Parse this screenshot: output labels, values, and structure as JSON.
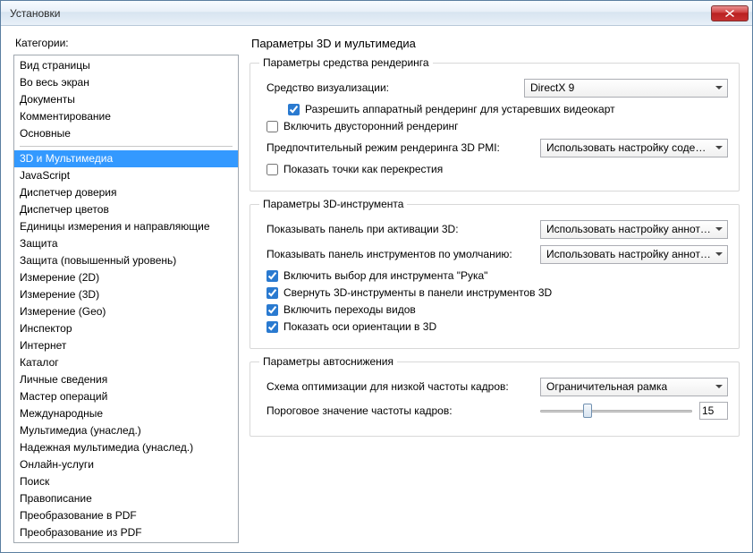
{
  "window": {
    "title": "Установки"
  },
  "sidebar": {
    "label": "Категории:",
    "group1": [
      "Вид страницы",
      "Во весь экран",
      "Документы",
      "Комментирование",
      "Основные"
    ],
    "group2": [
      "3D и Мультимедиа",
      "JavaScript",
      "Диспетчер доверия",
      "Диспетчер цветов",
      "Единицы измерения и направляющие",
      "Защита",
      "Защита (повышенный уровень)",
      "Измерение (2D)",
      "Измерение (3D)",
      "Измерение (Geo)",
      "Инспектор",
      "Интернет",
      "Каталог",
      "Личные сведения",
      "Мастер операций",
      "Международные",
      "Мультимедиа (унаслед.)",
      "Надежная мультимедиа (унаслед.)",
      "Онлайн-услуги",
      "Поиск",
      "Правописание",
      "Преобразование в PDF",
      "Преобразование из PDF"
    ],
    "selected": "3D и Мультимедиа"
  },
  "page": {
    "title": "Параметры 3D и мультимедиа",
    "group_render": {
      "legend": "Параметры средства рендеринга",
      "viz_label": "Средство визуализации:",
      "viz_value": "DirectX 9",
      "hw_label": "Разрешить аппаратный рендеринг для устаревших видеокарт",
      "hw_checked": true,
      "two_side_label": "Включить двусторонний рендеринг",
      "two_side_checked": false,
      "pmi_label": "Предпочтительный режим рендеринга 3D PMI:",
      "pmi_value": "Использовать настройку содержимого",
      "crosshair_label": "Показать точки как перекрестия",
      "crosshair_checked": false
    },
    "group_tool": {
      "legend": "Параметры 3D-инструмента",
      "panel_on_activate_label": "Показывать панель при активации 3D:",
      "panel_on_activate_value": "Использовать настройку аннотаций",
      "default_toolbar_label": "Показывать панель инструментов по умолчанию:",
      "default_toolbar_value": "Использовать настройку аннотаций",
      "hand_label": "Включить выбор для инструмента \"Рука\"",
      "hand_checked": true,
      "collapse_label": "Свернуть 3D-инструменты в панели инструментов 3D",
      "collapse_checked": true,
      "transitions_label": "Включить переходы видов",
      "transitions_checked": true,
      "axes_label": "Показать оси ориентации в 3D",
      "axes_checked": true
    },
    "group_auto": {
      "legend": "Параметры автоснижения",
      "scheme_label": "Схема оптимизации для низкой частоты кадров:",
      "scheme_value": "Ограничительная рамка",
      "threshold_label": "Пороговое значение частоты кадров:",
      "threshold_value": "15"
    }
  }
}
